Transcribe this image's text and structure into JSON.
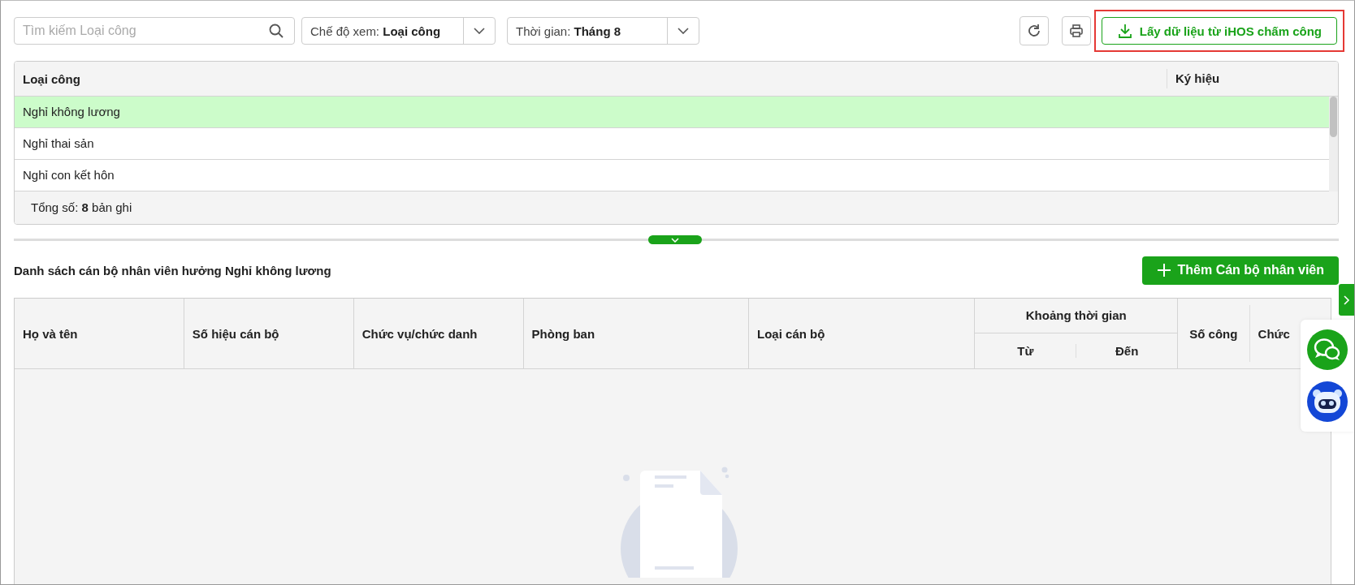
{
  "toolbar": {
    "search": {
      "placeholder": "Tìm kiếm Loại công"
    },
    "view_mode": {
      "label": "Chế độ xem:",
      "value": "Loại công"
    },
    "period": {
      "label": "Thời gian:",
      "value": "Tháng 8"
    },
    "import_button": {
      "label": "Lấy dữ liệu từ iHOS chấm công",
      "highlighted": true
    }
  },
  "types_table": {
    "columns": [
      "Loại công",
      "Ký hiệu"
    ],
    "rows": [
      {
        "name": "Nghỉ không lương",
        "selected": true
      },
      {
        "name": "Nghỉ thai sản",
        "selected": false
      },
      {
        "name": "Nghỉ con kết hôn",
        "selected": false
      }
    ],
    "footer": {
      "label": "Tổng số:",
      "count": "8",
      "unit": "bản ghi"
    }
  },
  "staff_section": {
    "title": "Danh sách cán bộ nhân viên hưởng Nghỉ không lương",
    "add_button": "Thêm Cán bộ nhân viên",
    "columns": [
      "Họ và tên",
      "Số hiệu cán bộ",
      "Chức vụ/chức danh",
      "Phòng ban",
      "Loại cán bộ"
    ],
    "period_group": {
      "title": "Khoảng thời gian",
      "sub_columns": [
        "Từ",
        "Đến"
      ]
    },
    "trailing_columns": [
      "Số công",
      "Chức"
    ]
  }
}
